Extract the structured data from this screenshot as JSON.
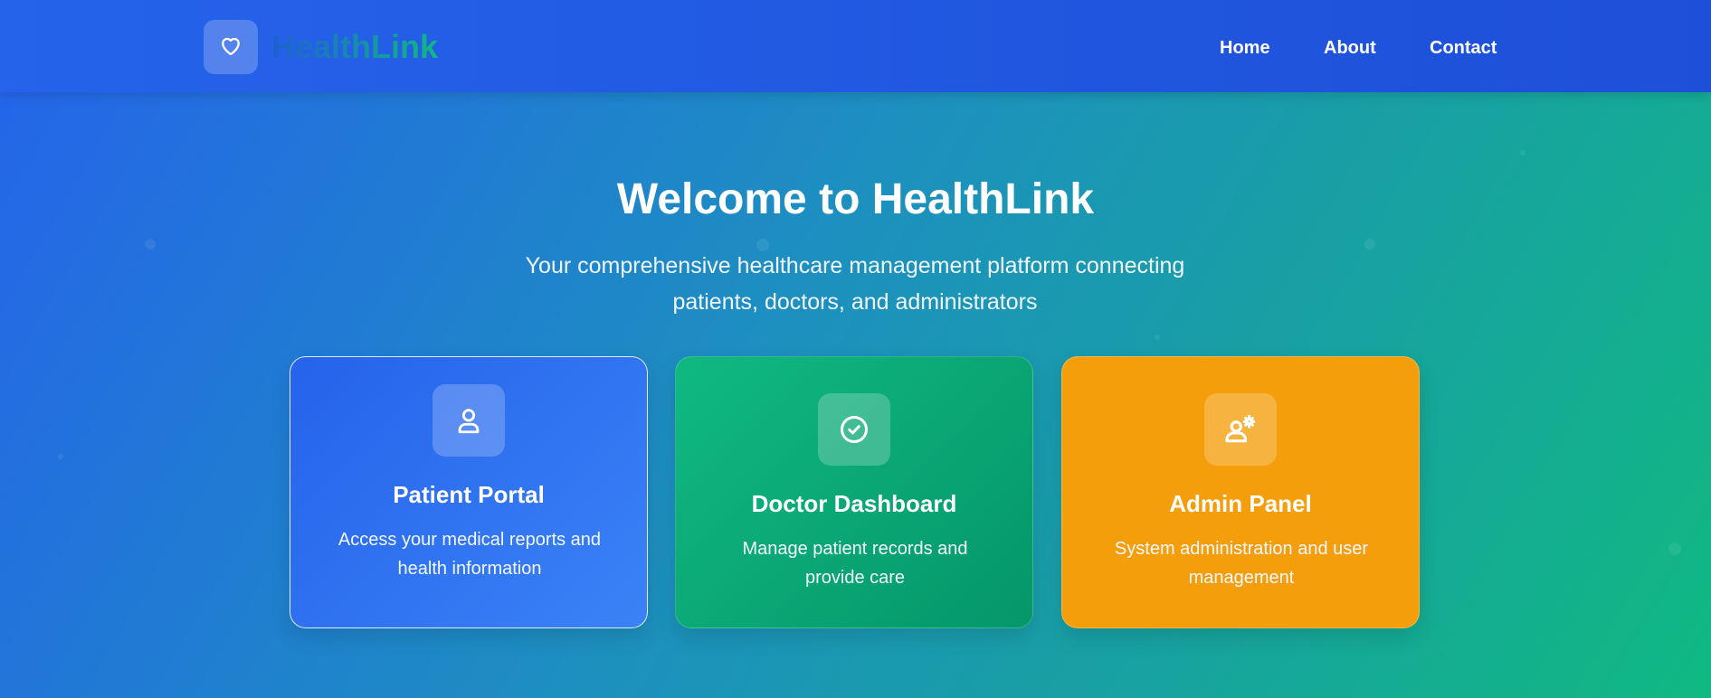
{
  "header": {
    "brand": "HealthLink",
    "logo_icon": "heart-icon",
    "nav": [
      {
        "label": "Home"
      },
      {
        "label": "About"
      },
      {
        "label": "Contact"
      }
    ]
  },
  "hero": {
    "title": "Welcome to HealthLink",
    "subtitle": "Your comprehensive healthcare management platform connecting patients, doctors, and administrators"
  },
  "cards": [
    {
      "title": "Patient Portal",
      "description": "Access your medical reports and health information",
      "icon": "user-icon",
      "color": "#2563eb"
    },
    {
      "title": "Doctor Dashboard",
      "description": "Manage patient records and provide care",
      "icon": "check-circle-icon",
      "color": "#10b981"
    },
    {
      "title": "Admin Panel",
      "description": "System administration and user management",
      "icon": "user-gear-icon",
      "color": "#f59e0b"
    }
  ],
  "colors": {
    "primary_blue": "#2563eb",
    "green": "#10b981",
    "amber": "#f59e0b"
  }
}
